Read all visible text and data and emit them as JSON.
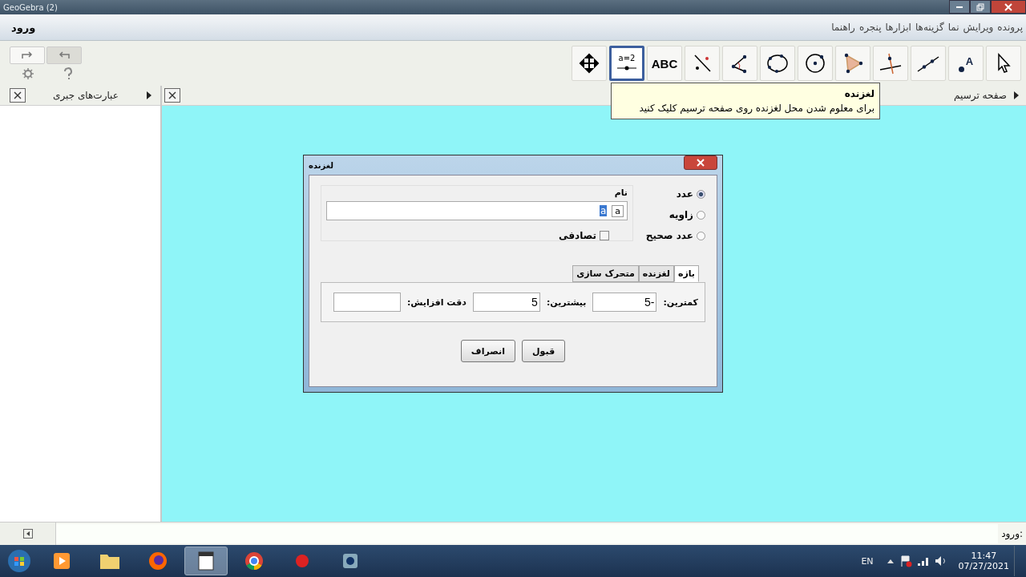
{
  "window": {
    "title": "GeoGebra (2)"
  },
  "menu": {
    "login": "ورود",
    "items": [
      "پرونده",
      "ویرایش",
      "نما",
      "گزینه‌ها",
      "ابزارها",
      "پنجره",
      "راهنما"
    ]
  },
  "tools": [
    {
      "kind": "pointer",
      "selected": false
    },
    {
      "kind": "point",
      "label": "A",
      "selected": false
    },
    {
      "kind": "line",
      "selected": false
    },
    {
      "kind": "perpendicular",
      "selected": false
    },
    {
      "kind": "polygon",
      "selected": false
    },
    {
      "kind": "circle",
      "selected": false
    },
    {
      "kind": "conic",
      "selected": false
    },
    {
      "kind": "angle",
      "selected": false
    },
    {
      "kind": "point-line",
      "selected": false
    },
    {
      "kind": "text",
      "label": "ABC",
      "selected": false
    },
    {
      "kind": "slider",
      "label": "a=2",
      "selected": true
    },
    {
      "kind": "move",
      "selected": false
    }
  ],
  "tooltip": {
    "title": "لغزنده",
    "text": "برای معلوم شدن محل لغزنده روی صفحه ترسیم کلیک کنید"
  },
  "algebra_view": {
    "title": "عبارت‌های جبری"
  },
  "graphics_view": {
    "title": "صفحه ترسیم"
  },
  "dialog": {
    "title": "لغزنده",
    "types": [
      {
        "label": "عدد",
        "selected": true
      },
      {
        "label": "زاویه",
        "selected": false
      },
      {
        "label": "عدد صحیح",
        "selected": false
      }
    ],
    "name_label": "نام",
    "name_prefix": "a",
    "name_value": "a",
    "random": {
      "label": "تصادفی",
      "checked": false
    },
    "tabs": [
      {
        "label": "بازه",
        "selected": true
      },
      {
        "label": "لغزنده",
        "selected": false
      },
      {
        "label": "متحرک سازی",
        "selected": false
      }
    ],
    "fields": [
      {
        "label": "کمترین:",
        "value": "-5"
      },
      {
        "label": "بیشترین:",
        "value": "5"
      },
      {
        "label": "دقت افزایش:"
      }
    ],
    "buttons": [
      "قبول",
      "انصراف"
    ]
  },
  "input_bar": {
    "label": "ورود:"
  },
  "taskbar": {
    "apps": [
      {
        "kind": "media",
        "selected": false
      },
      {
        "kind": "folder",
        "selected": false
      },
      {
        "kind": "firefox",
        "selected": false
      },
      {
        "kind": "document",
        "selected": true
      },
      {
        "kind": "chrome",
        "selected": false
      },
      {
        "kind": "recorder",
        "selected": false
      },
      {
        "kind": "camera",
        "selected": false
      }
    ],
    "language": "EN",
    "time": "11:47",
    "date": "07/27/2021"
  }
}
